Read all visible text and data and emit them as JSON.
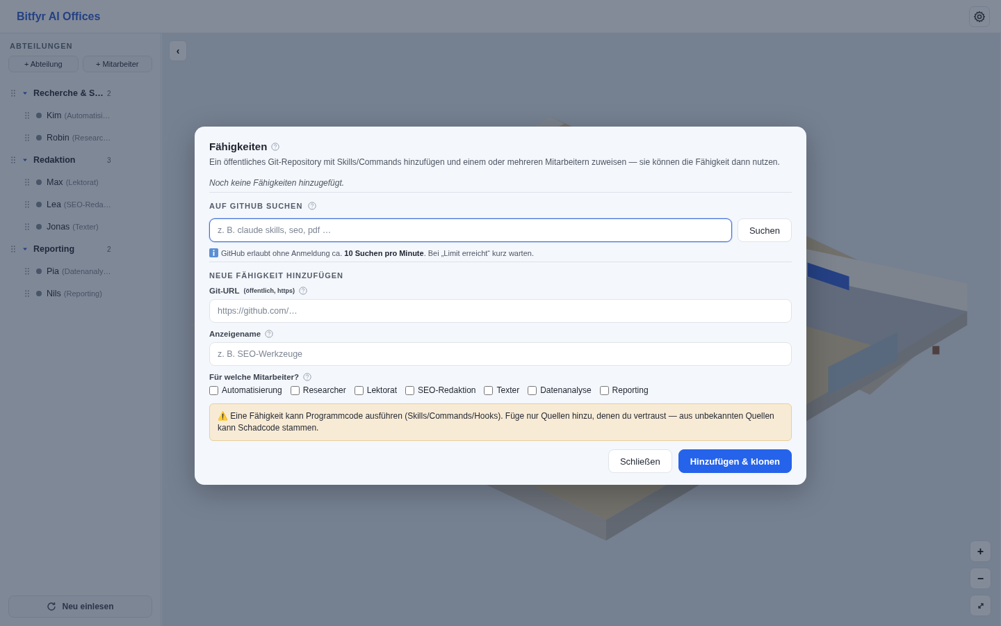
{
  "app": {
    "title": "Bitfyr AI Offices"
  },
  "sidebar": {
    "heading": "ABTEILUNGEN",
    "buttons": [
      "+ Abteilung",
      "+ Mitarbeiter"
    ],
    "departments": [
      {
        "name": "Recherche & S…",
        "count": "2",
        "expanded": true,
        "children": [
          {
            "name": "Kim",
            "role": "(Automatisi…"
          },
          {
            "name": "Robin",
            "role": "(Researc…"
          }
        ]
      },
      {
        "name": "Redaktion",
        "count": "3",
        "expanded": true,
        "children": [
          {
            "name": "Max",
            "role": "(Lektorat)"
          },
          {
            "name": "Lea",
            "role": "(SEO-Reda…"
          },
          {
            "name": "Jonas",
            "role": "(Texter)"
          }
        ]
      },
      {
        "name": "Reporting",
        "count": "2",
        "expanded": true,
        "children": [
          {
            "name": "Pia",
            "role": "(Datenanaly…"
          },
          {
            "name": "Nils",
            "role": "(Reporting)"
          }
        ]
      }
    ],
    "reload_button": "Neu einlesen"
  },
  "canvas": {
    "collapse_button": "‹",
    "zoom_in": "+",
    "zoom_out": "−"
  },
  "dialog": {
    "title": "Fähigkeiten",
    "description": "Ein öffentliches Git-Repository mit Skills/Commands hinzufügen und einem oder mehreren Mitarbeitern zuweisen — sie können die Fähigkeit dann nutzen.",
    "empty_note": "Noch keine Fähigkeiten hinzugefügt.",
    "search_heading": "AUF GITHUB SUCHEN",
    "search": {
      "placeholder": "z. B. claude skills, seo, pdf …",
      "button": "Suchen"
    },
    "search_hint": "GitHub erlaubt ohne Anmeldung ca. **10 Suchen pro Minute**. Bei „Limit erreicht“ kurz warten.",
    "add_heading": "NEUE FÄHIGKEIT HINZUFÜGEN",
    "url_field": {
      "label": "Git-URL",
      "label_note": "(öffentlich, https)",
      "placeholder": "https://github.com/…"
    },
    "name_field": {
      "label": "Anzeigename",
      "placeholder": "z. B. SEO-Werkzeuge"
    },
    "assign_label": "Für welche Mitarbeiter?",
    "assignees": [
      {
        "label": "Automatisierung",
        "checked": false
      },
      {
        "label": "Researcher",
        "checked": false
      },
      {
        "label": "Lektorat",
        "checked": false
      },
      {
        "label": "SEO-Redaktion",
        "checked": false
      },
      {
        "label": "Texter",
        "checked": false
      },
      {
        "label": "Datenanalyse",
        "checked": false
      },
      {
        "label": "Reporting",
        "checked": false
      }
    ],
    "warning": "⚠️ Eine Fähigkeit kann Programmcode ausführen (Skills/Commands/Hooks). Füge nur Quellen hinzu, denen du vertraust — aus unbekannten Quellen kann Schadcode stammen.",
    "buttons": [
      {
        "label": "Schließen",
        "kind": "secondary"
      },
      {
        "label": "Hinzufügen & klonen",
        "kind": "primary"
      }
    ]
  }
}
